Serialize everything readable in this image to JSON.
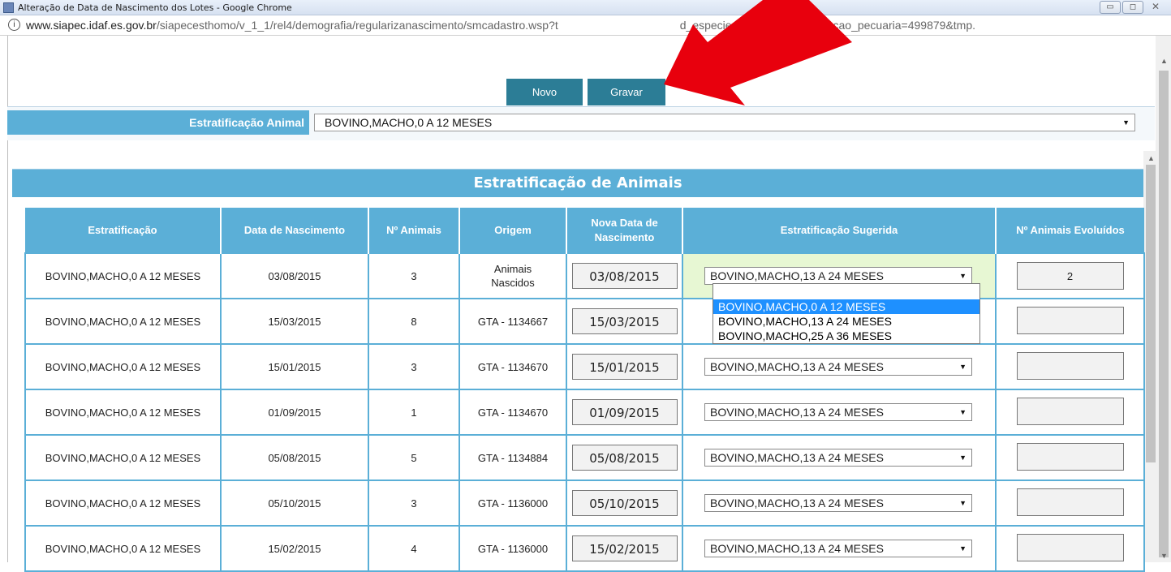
{
  "window": {
    "title": "Alteração de Data de Nascimento dos Lotes - Google Chrome",
    "url_host": "www.siapec.idaf.es.gov.br",
    "url_path_start": "/siapecesthomo/v_1_1/rel4/demografia/regularizanascimento/smcadastro.wsp?t",
    "url_path_end": "d_especie=13&tmp.id_exploracao_pecuaria=499879&tmp."
  },
  "toolbar": {
    "novo_label": "Novo",
    "gravar_label": "Gravar"
  },
  "filter": {
    "label": "Estratificação Animal",
    "value": "BOVINO,MACHO,0 A 12 MESES"
  },
  "section": {
    "title": "Estratificação de Animais"
  },
  "table": {
    "headers": [
      "Estratificação",
      "Data de Nascimento",
      "Nº Animais",
      "Origem",
      "Nova Data de Nascimento",
      "Estratificação Sugerida",
      "Nº Animais Evoluídos"
    ],
    "rows": [
      {
        "estratificacao": "BOVINO,MACHO,0 A 12 MESES",
        "data": "03/08/2015",
        "num": "3",
        "origem": "Animais Nascidos",
        "nova_data": "03/08/2015",
        "sugerida": "BOVINO,MACHO,13 A 24 MESES",
        "evoluidos": "2"
      },
      {
        "estratificacao": "BOVINO,MACHO,0 A 12 MESES",
        "data": "15/03/2015",
        "num": "8",
        "origem": "GTA - 1134667",
        "nova_data": "15/03/2015",
        "sugerida": "",
        "evoluidos": ""
      },
      {
        "estratificacao": "BOVINO,MACHO,0 A 12 MESES",
        "data": "15/01/2015",
        "num": "3",
        "origem": "GTA - 1134670",
        "nova_data": "15/01/2015",
        "sugerida": "BOVINO,MACHO,13 A 24 MESES",
        "evoluidos": ""
      },
      {
        "estratificacao": "BOVINO,MACHO,0 A 12 MESES",
        "data": "01/09/2015",
        "num": "1",
        "origem": "GTA - 1134670",
        "nova_data": "01/09/2015",
        "sugerida": "BOVINO,MACHO,13 A 24 MESES",
        "evoluidos": ""
      },
      {
        "estratificacao": "BOVINO,MACHO,0 A 12 MESES",
        "data": "05/08/2015",
        "num": "5",
        "origem": "GTA - 1134884",
        "nova_data": "05/08/2015",
        "sugerida": "BOVINO,MACHO,13 A 24 MESES",
        "evoluidos": ""
      },
      {
        "estratificacao": "BOVINO,MACHO,0 A 12 MESES",
        "data": "05/10/2015",
        "num": "3",
        "origem": "GTA - 1136000",
        "nova_data": "05/10/2015",
        "sugerida": "BOVINO,MACHO,13 A 24 MESES",
        "evoluidos": ""
      },
      {
        "estratificacao": "BOVINO,MACHO,0 A 12 MESES",
        "data": "15/02/2015",
        "num": "4",
        "origem": "GTA - 1136000",
        "nova_data": "15/02/2015",
        "sugerida": "BOVINO,MACHO,13 A 24 MESES",
        "evoluidos": ""
      }
    ]
  },
  "dropdown_options": [
    "",
    "BOVINO,MACHO,0 A 12 MESES",
    "BOVINO,MACHO,13 A 24 MESES",
    "BOVINO,MACHO,25 A 36 MESES"
  ],
  "icons": {
    "info": "info-icon",
    "dropdown": "chevron-down-icon",
    "annotation": "red-arrow-icon"
  },
  "colors": {
    "accent": "#5bafd7",
    "button": "#2c7d96",
    "highlight": "#e7f7d3",
    "selected_option": "#1e90ff",
    "annotation": "#e8000d"
  }
}
